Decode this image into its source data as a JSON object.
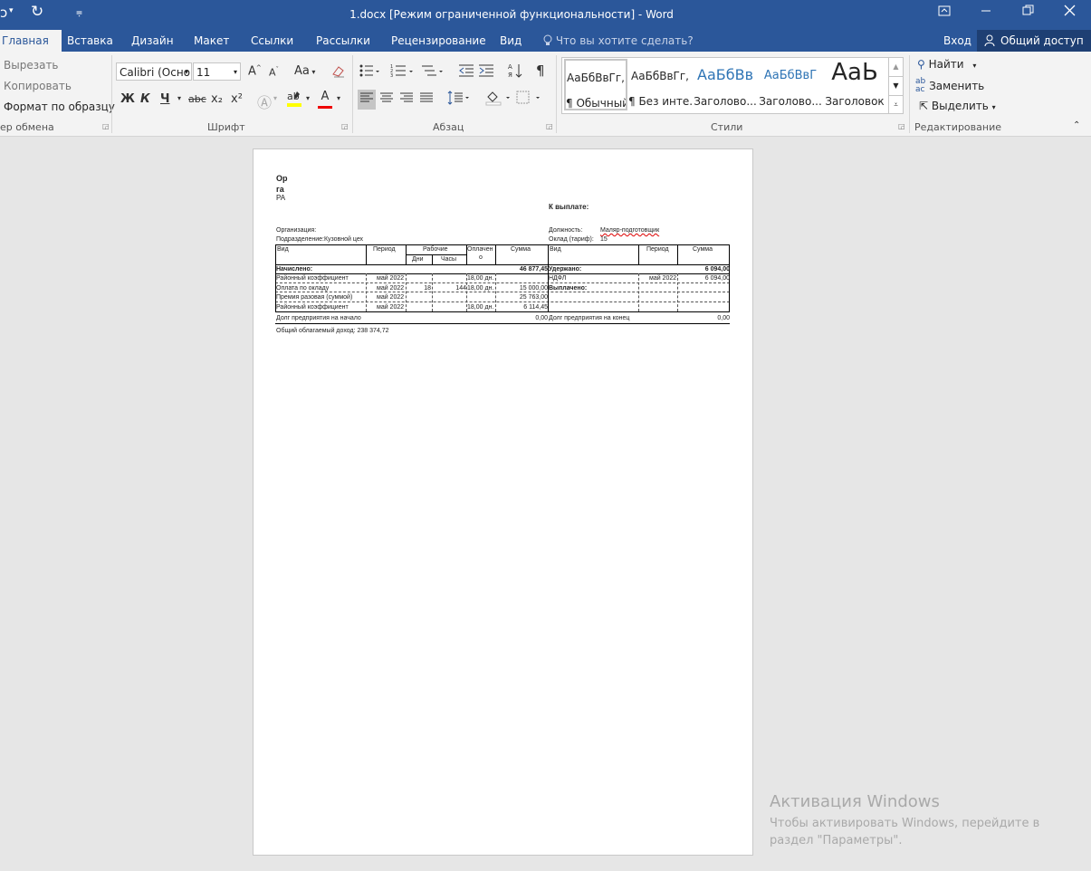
{
  "titlebar": {
    "title": "1.docx [Режим ограниченной функциональности] - Word",
    "qa_redo": "↻",
    "qa_more": "⩦",
    "qa_undo_arrow": "▾",
    "qa_undo": "ɔ"
  },
  "tabs": [
    {
      "label": "Главная"
    },
    {
      "label": "Вставка"
    },
    {
      "label": "Дизайн"
    },
    {
      "label": "Макет"
    },
    {
      "label": "Ссылки"
    },
    {
      "label": "Рассылки"
    },
    {
      "label": "Рецензирование"
    },
    {
      "label": "Вид"
    }
  ],
  "tell_me": "Что вы хотите сделать?",
  "sign_in": "Вход",
  "share": "Общий доступ",
  "clipboard": {
    "cut": "Вырезать",
    "copy": "Копировать",
    "format_painter": "Формат по образцу",
    "label": "ер обмена"
  },
  "font": {
    "name": "Calibri (Осно",
    "size": "11",
    "label": "Шрифт",
    "bold": "Ж",
    "italic": "К",
    "underline": "Ч",
    "strike": "abc",
    "sub": "x₂",
    "sup": "x²",
    "grow": "A",
    "shrink": "A",
    "case": "Aa",
    "color_a": "A"
  },
  "paragraph": {
    "label": "Абзац"
  },
  "styles": {
    "label": "Стили",
    "items": [
      {
        "sample": "АаБбВвГг,",
        "name": "¶ Обычный"
      },
      {
        "sample": "АаБбВвГг,",
        "name": "¶ Без инте..."
      },
      {
        "sample": "АаБбВв",
        "name": "Заголово..."
      },
      {
        "sample": "АаБбВвГ",
        "name": "Заголово..."
      },
      {
        "sample": "АаЬ",
        "name": "Заголовок"
      }
    ]
  },
  "editing": {
    "find": "Найти",
    "replace": "Заменить",
    "select": "Выделить",
    "label": "Редактирование"
  },
  "document": {
    "org_short_1": "Ор",
    "org_short_2": "га",
    "org_short_3": "РА",
    "to_pay": "К выплате:",
    "organization": "Организация:",
    "department": "Подразделение:Кузовной цех",
    "position_label": "Должность:",
    "position_value": "Маляр-подготовщик",
    "salary_label": "Оклад (тариф):",
    "salary_value": "15",
    "headers_left": {
      "vid": "Вид",
      "period": "Период",
      "work": "Рабочие",
      "days": "Дни",
      "hours": "Часы",
      "paid": "Оплачен",
      "paid2": "о",
      "sum": "Сумма"
    },
    "headers_right": {
      "vid": "Вид",
      "period": "Период",
      "sum": "Сумма"
    },
    "accrued_label": "Начислено:",
    "accrued_total": "46 877,45",
    "withheld_label": "Удержано:",
    "withheld_total": "6 094,00",
    "paid_label": "Выплачено:",
    "left_rows": [
      {
        "vid": "Районный коэффициент",
        "period": "май 2022",
        "days": "",
        "hours": "",
        "paid": "18,00 дн.",
        "sum": ""
      },
      {
        "vid": "Оплата по окладу",
        "period": "май 2022",
        "days": "18",
        "hours": "144",
        "paid": "18,00 дн.",
        "sum": "15 000,00"
      },
      {
        "vid": "Премия разовая (суммой)",
        "period": "май 2022",
        "days": "",
        "hours": "",
        "paid": "",
        "sum": "25 763,00"
      },
      {
        "vid": "Районный коэффициент",
        "period": "май 2022",
        "days": "",
        "hours": "",
        "paid": "18,00 дн.",
        "sum": "6 114,45"
      }
    ],
    "right_rows": [
      {
        "vid": "НДФЛ",
        "period": "май 2022",
        "sum": "6 094,00"
      }
    ],
    "debt_start_label": "Долг предприятия на начало",
    "debt_start": "0,00",
    "debt_end_label": "Долг предприятия на конец",
    "debt_end": "0,00",
    "taxable_income": "Общий облагаемый доход: 238 374,72"
  },
  "activation": {
    "title": "Активация Windows",
    "text": "Чтобы активировать Windows, перейдите в раздел \"Параметры\"."
  }
}
